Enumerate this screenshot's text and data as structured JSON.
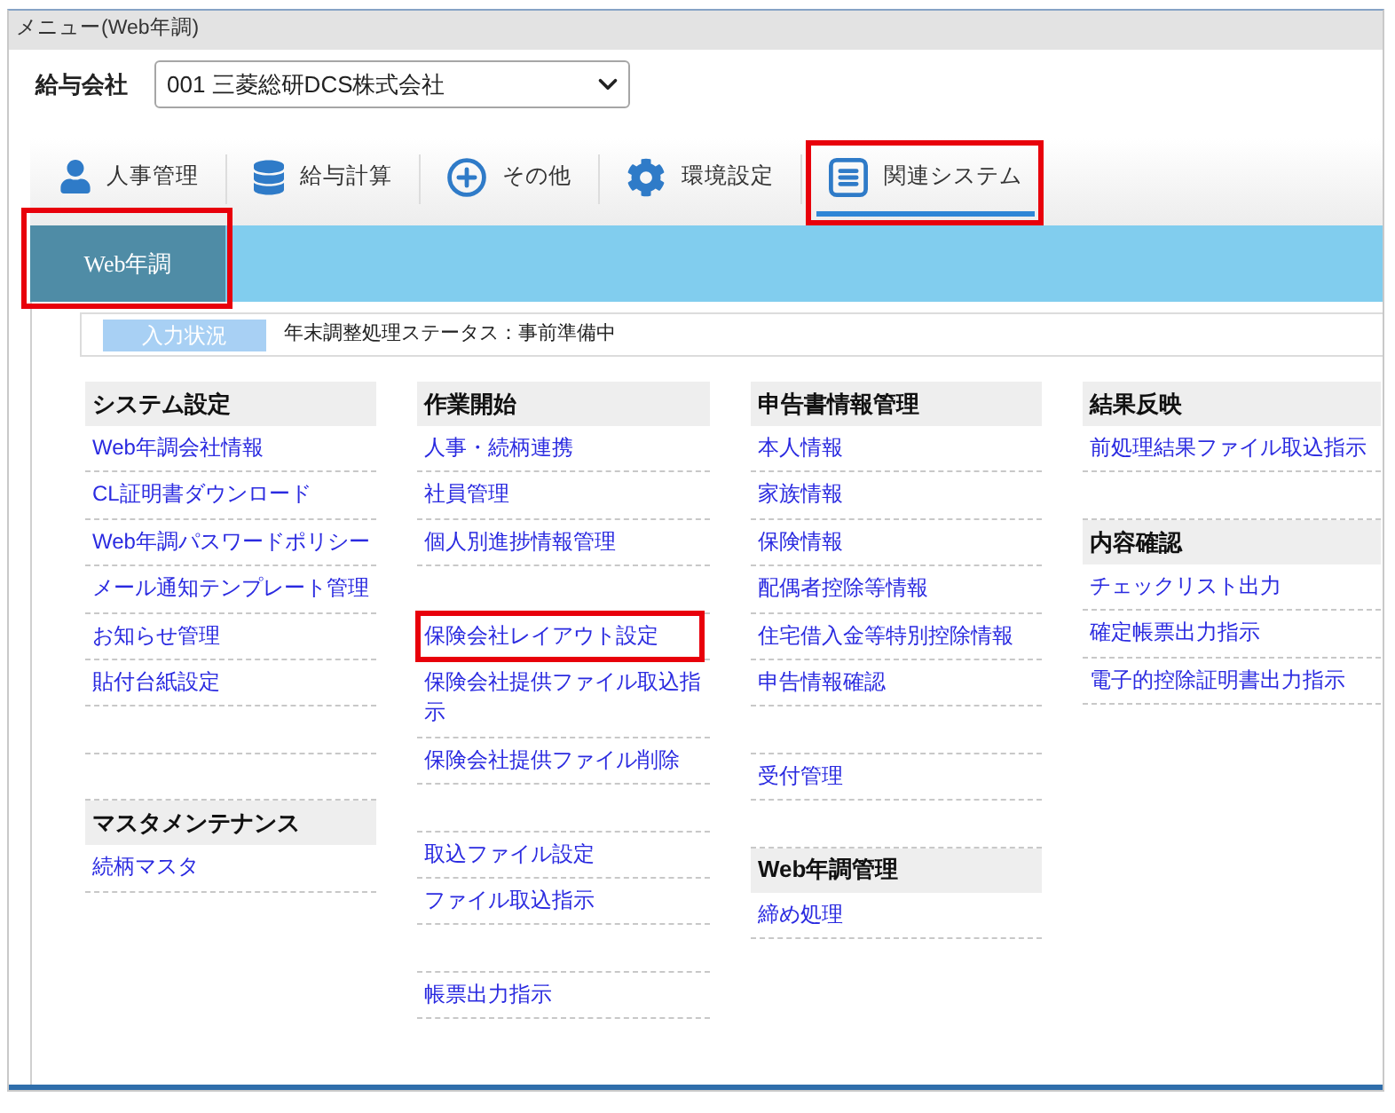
{
  "window": {
    "title": "メニュー(Web年調)"
  },
  "company": {
    "label": "給与会社",
    "value": "001 三菱総研DCS株式会社"
  },
  "tabs": [
    {
      "label": "人事管理",
      "selected": false,
      "highlighted": false
    },
    {
      "label": "給与計算",
      "selected": false,
      "highlighted": false
    },
    {
      "label": "その他",
      "selected": false,
      "highlighted": false
    },
    {
      "label": "環境設定",
      "selected": false,
      "highlighted": false
    },
    {
      "label": "関連システム",
      "selected": true,
      "highlighted": true
    }
  ],
  "subnav": [
    {
      "label": "Web年調",
      "selected": true,
      "highlighted": true
    }
  ],
  "status": {
    "label": "入力状況",
    "text": "年末調整処理ステータス：事前準備中"
  },
  "menu_columns": [
    {
      "entries": [
        {
          "kind": "heading",
          "label": "システム設定"
        },
        {
          "kind": "link",
          "label": "Web年調会社情報",
          "highlighted": false
        },
        {
          "kind": "link",
          "label": "CL証明書ダウンロード",
          "highlighted": false
        },
        {
          "kind": "link",
          "label": "Web年調パスワードポリシー",
          "highlighted": false
        },
        {
          "kind": "link",
          "label": "メール通知テンプレート管理",
          "highlighted": false
        },
        {
          "kind": "link",
          "label": "お知らせ管理",
          "highlighted": false
        },
        {
          "kind": "link",
          "label": "貼付台紙設定",
          "highlighted": false
        },
        {
          "kind": "blank"
        },
        {
          "kind": "blank"
        },
        {
          "kind": "heading",
          "label": "マスタメンテナンス"
        },
        {
          "kind": "link",
          "label": "続柄マスタ",
          "highlighted": false
        }
      ]
    },
    {
      "entries": [
        {
          "kind": "heading",
          "label": "作業開始"
        },
        {
          "kind": "link",
          "label": "人事・続柄連携",
          "highlighted": false
        },
        {
          "kind": "link",
          "label": "社員管理",
          "highlighted": false
        },
        {
          "kind": "link",
          "label": "個人別進捗情報管理",
          "highlighted": false
        },
        {
          "kind": "blank"
        },
        {
          "kind": "link",
          "label": "保険会社レイアウト設定",
          "highlighted": true
        },
        {
          "kind": "link",
          "label": "保険会社提供ファイル取込指示",
          "highlighted": false
        },
        {
          "kind": "link",
          "label": "保険会社提供ファイル削除",
          "highlighted": false
        },
        {
          "kind": "blank"
        },
        {
          "kind": "link",
          "label": "取込ファイル設定",
          "highlighted": false
        },
        {
          "kind": "link",
          "label": "ファイル取込指示",
          "highlighted": false
        },
        {
          "kind": "blank"
        },
        {
          "kind": "link",
          "label": "帳票出力指示",
          "highlighted": false
        }
      ]
    },
    {
      "entries": [
        {
          "kind": "heading",
          "label": "申告書情報管理"
        },
        {
          "kind": "link",
          "label": "本人情報",
          "highlighted": false
        },
        {
          "kind": "link",
          "label": "家族情報",
          "highlighted": false
        },
        {
          "kind": "link",
          "label": "保険情報",
          "highlighted": false
        },
        {
          "kind": "link",
          "label": "配偶者控除等情報",
          "highlighted": false
        },
        {
          "kind": "link",
          "label": "住宅借入金等特別控除情報",
          "highlighted": false
        },
        {
          "kind": "link",
          "label": "申告情報確認",
          "highlighted": false
        },
        {
          "kind": "blank"
        },
        {
          "kind": "link",
          "label": "受付管理",
          "highlighted": false
        },
        {
          "kind": "blank"
        },
        {
          "kind": "heading",
          "label": "Web年調管理"
        },
        {
          "kind": "link",
          "label": "締め処理",
          "highlighted": false
        }
      ]
    },
    {
      "entries": [
        {
          "kind": "heading",
          "label": "結果反映"
        },
        {
          "kind": "link",
          "label": "前処理結果ファイル取込指示",
          "highlighted": false
        },
        {
          "kind": "blank"
        },
        {
          "kind": "heading",
          "label": "内容確認"
        },
        {
          "kind": "link",
          "label": "チェックリスト出力",
          "highlighted": false
        },
        {
          "kind": "link",
          "label": "確定帳票出力指示",
          "highlighted": false
        },
        {
          "kind": "link",
          "label": "電子的控除証明書出力指示",
          "highlighted": false
        }
      ]
    }
  ]
}
